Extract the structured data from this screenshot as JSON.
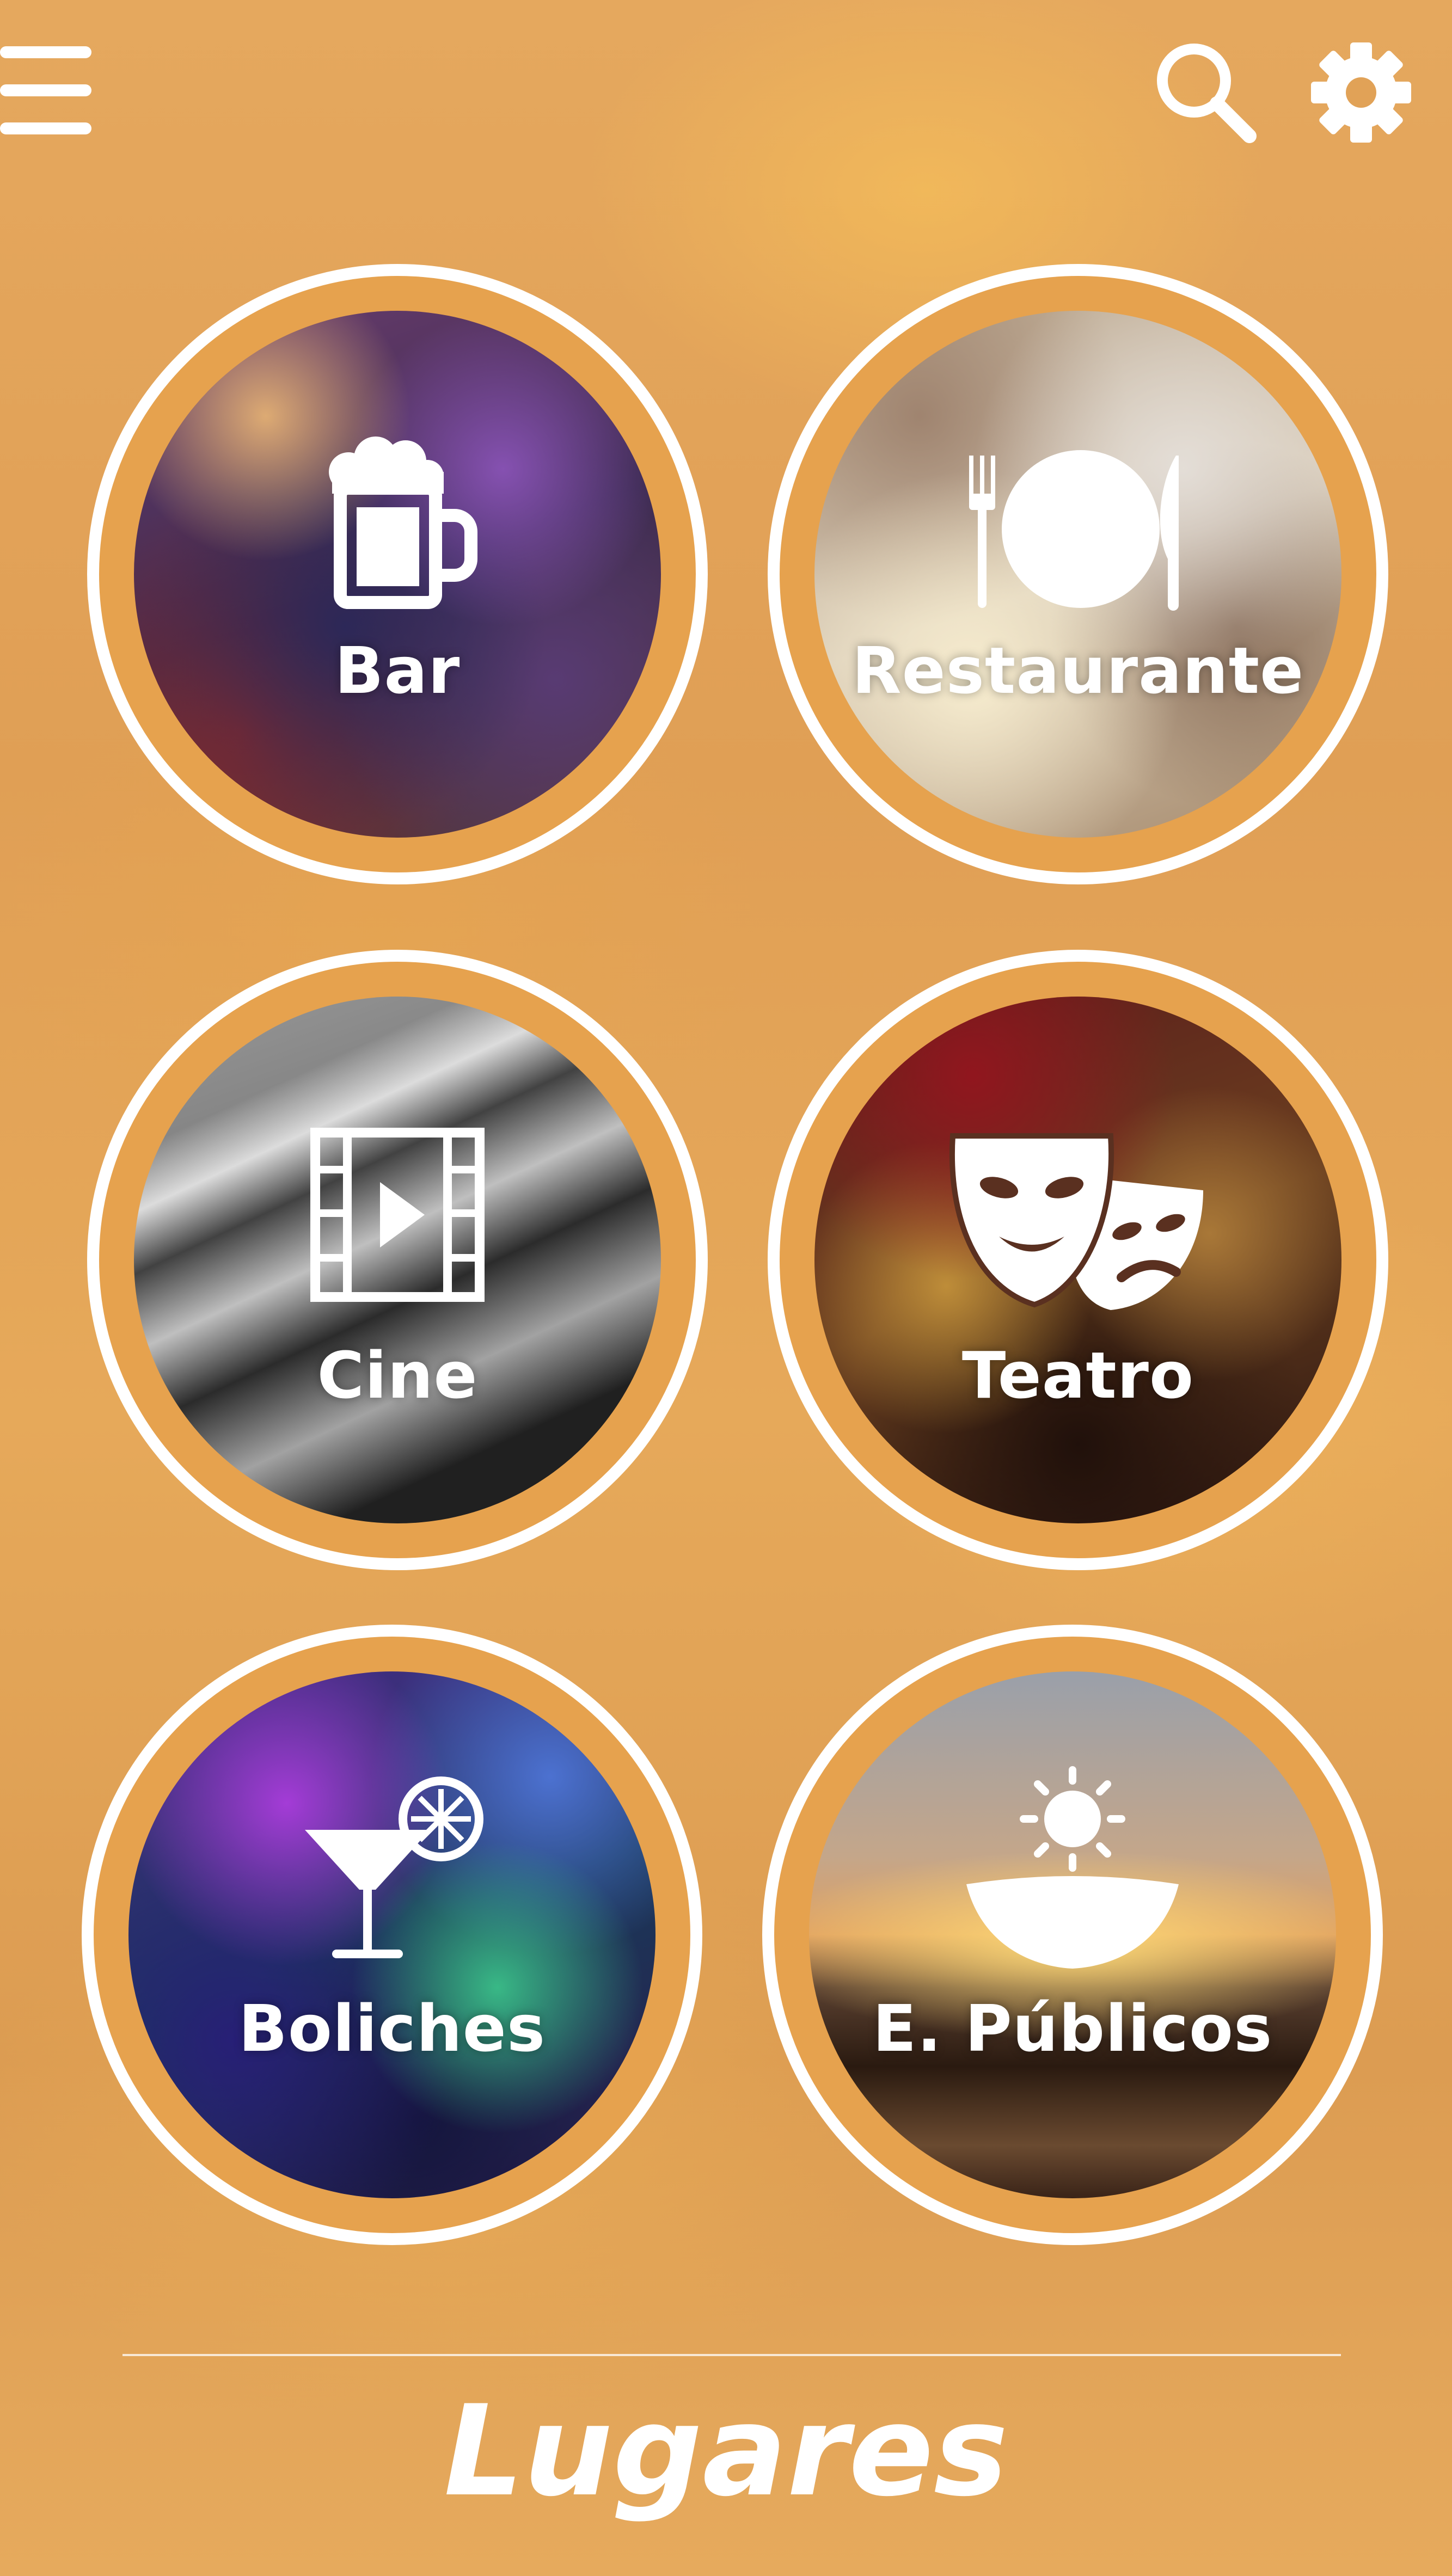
{
  "header": {
    "menu_icon": "hamburger-menu-icon",
    "search_icon": "search-icon",
    "settings_icon": "gear-icon"
  },
  "categories": [
    {
      "label": "Bar",
      "icon": "beer-mug-icon"
    },
    {
      "label": "Restaurante",
      "icon": "plate-cutlery-icon"
    },
    {
      "label": "Cine",
      "icon": "film-strip-icon"
    },
    {
      "label": "Teatro",
      "icon": "theater-masks-icon"
    },
    {
      "label": "Boliches",
      "icon": "cocktail-icon"
    },
    {
      "label": "E. Públicos",
      "icon": "sun-island-icon"
    }
  ],
  "footer": {
    "title": "Lugares"
  },
  "colors": {
    "background": "#e3a458",
    "ring": "#ffffff",
    "ring_inner": "#e6a24e",
    "text": "#ffffff"
  }
}
